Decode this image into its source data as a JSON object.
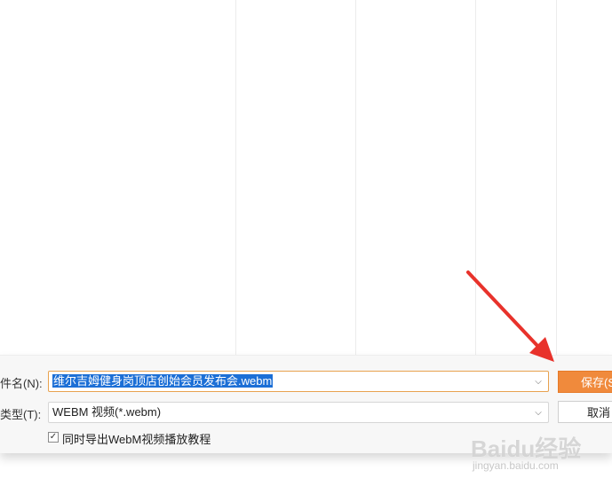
{
  "file_name": {
    "label": "件名(N):",
    "value": "维尔吉姆健身岗顶店创始会员发布会.webm"
  },
  "file_type": {
    "label": "类型(T):",
    "value": "WEBM 视频(*.webm)"
  },
  "buttons": {
    "save": "保存(S)",
    "cancel": "取消"
  },
  "export_tutorial": {
    "checked": true,
    "label": "同时导出WebM视频播放教程"
  },
  "colors": {
    "accent": "#f08a3c",
    "annotation_arrow": "#e8322b",
    "selection": "#1c6fd6"
  },
  "watermark": {
    "logo": "Baidu经验",
    "sub": "jingyan.baidu.com"
  }
}
